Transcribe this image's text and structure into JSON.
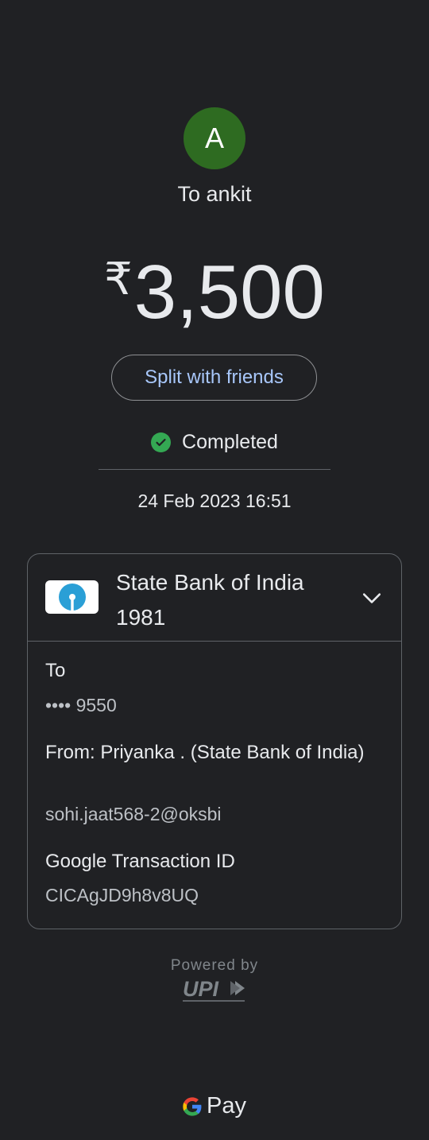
{
  "recipient": {
    "initial": "A",
    "label": "To ankit",
    "avatar_color": "#2e6b21"
  },
  "payment": {
    "currency_symbol": "₹",
    "amount": "3,500"
  },
  "actions": {
    "split_label": "Split with friends"
  },
  "status": {
    "text": "Completed",
    "icon": "check-circle-icon",
    "color": "#34a853"
  },
  "datetime": "24 Feb 2023 16:51",
  "bank": {
    "name_line1": "State Bank of India",
    "name_line2": "1981",
    "logo": "sbi-logo-icon"
  },
  "details": {
    "to_label": "To",
    "to_value": "•••• 9550",
    "from_label": "From: Priyanka  . (State Bank of India)",
    "from_value": "sohi.jaat568-2@oksbi",
    "txn_label": "Google Transaction ID",
    "txn_value": "CICAgJD9h8v8UQ"
  },
  "footer": {
    "powered_by": "Powered by",
    "upi_logo": "upi-logo",
    "upi_text": "UPI",
    "gpay_label": "Pay"
  }
}
